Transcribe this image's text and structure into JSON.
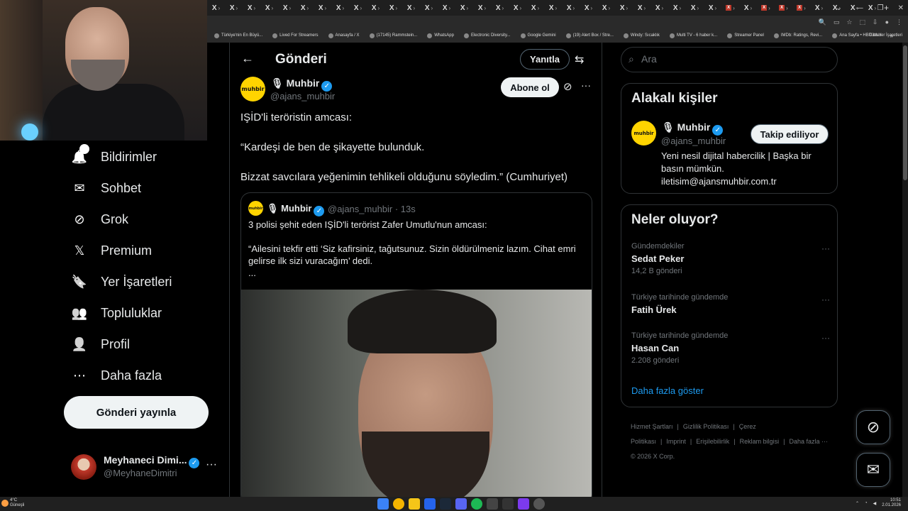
{
  "browser": {
    "tab_labels": [
      "X",
      "X",
      "X",
      "X",
      "X",
      "X",
      "X",
      "X",
      "X",
      "X",
      "X",
      "X",
      "X",
      "X",
      "X",
      "X",
      "X",
      "X",
      "X",
      "X",
      "X",
      "X",
      "X",
      "X",
      "X",
      "X",
      "X",
      "X",
      "X",
      "X",
      "X",
      "X",
      "X",
      "X",
      "X",
      "X",
      "X",
      "X"
    ],
    "new_tab": "+",
    "bookmarks": [
      "Türkiye'nin En Büyü...",
      "Lived For Streamers",
      "Anasayfa / X",
      "(17145) Rammstein...",
      "WhatsApp",
      "Electronic Diversity...",
      "Google Gemini",
      "(19) Alert Box / Stre...",
      "Windy: Sıcaklık",
      "Multi TV - 6 haber k...",
      "Streamer Panel",
      "IMDb: Ratings, Revi...",
      "Ana Sayfa • HBO Max"
    ],
    "bookmarks_overflow": "»",
    "all_bookmarks": "Tüm Yer İşaretleri"
  },
  "nav": {
    "items": [
      {
        "label": "Bildirimler",
        "icon": "bell-icon",
        "badge": "2"
      },
      {
        "label": "Sohbet",
        "icon": "envelope-icon"
      },
      {
        "label": "Grok",
        "icon": "grok-icon"
      },
      {
        "label": "Premium",
        "icon": "x-logo-icon"
      },
      {
        "label": "Yer İşaretleri",
        "icon": "bookmark-icon"
      },
      {
        "label": "Topluluklar",
        "icon": "people-icon"
      },
      {
        "label": "Profil",
        "icon": "person-icon"
      },
      {
        "label": "Daha fazla",
        "icon": "more-circle-icon"
      }
    ],
    "post_button": "Gönderi yayınla",
    "account": {
      "name": "Meyhaneci Dimi...",
      "handle": "@MeyhaneDimitri"
    }
  },
  "main": {
    "title": "Gönderi",
    "reply_button": "Yanıtla",
    "author": {
      "name": "Muhbir",
      "handle": "@ajans_muhbir",
      "logo": "muhbir"
    },
    "subscribe_button": "Abone ol",
    "text": [
      "IŞİD'li teröristin amcası:",
      "“Kardeşi de ben de şikayette bulunduk.",
      "Bizzat savcılara yeğenimin tehlikeli olduğunu söyledim.” (Cumhuriyet)"
    ],
    "quote": {
      "name": "Muhbir",
      "handle": "@ajans_muhbir · 13s",
      "logo": "muhbir",
      "lines": [
        "3 polisi şehit eden IŞİD'li terörist Zafer Umutlu'nun amcası:",
        "“Ailesini tekfir etti ‘Siz kafirsiniz, tağutsunuz. Sizin öldürülmeniz lazım. Cihat emri gelirse ilk sizi vuracağım’ dedi.",
        "..."
      ]
    }
  },
  "right": {
    "search_placeholder": "Ara",
    "related": {
      "title": "Alakalı kişiler",
      "name": "Muhbir",
      "handle": "@ajans_muhbir",
      "logo": "muhbir",
      "follow_button": "Takip ediliyor",
      "bio": "Yeni nesil dijital habercilik | Başka bir basın mümkün. iletisim@ajansmuhbir.com.tr"
    },
    "trends": {
      "title": "Neler oluyor?",
      "items": [
        {
          "context": "Gündemdekiler",
          "title": "Sedat Peker",
          "count": "14,2 B gönderi"
        },
        {
          "context": "Türkiye tarihinde gündemde",
          "title": "Fatih Ürek",
          "count": ""
        },
        {
          "context": "Türkiye tarihinde gündemde",
          "title": "Hasan Can",
          "count": "2.208 gönderi"
        }
      ],
      "show_more": "Daha fazla göster"
    },
    "footer": {
      "links": [
        "Hizmet Şartları",
        "|",
        "Gizlilik Politikası",
        "|",
        "Çerez Politikası",
        "|",
        "Imprint",
        "|",
        "Erişilebilirlik",
        "|",
        "Reklam bilgisi",
        "|",
        "Daha fazla ···"
      ],
      "copyright": "© 2026 X Corp."
    }
  },
  "taskbar": {
    "weather_temp": "4°C",
    "weather_desc": "Güneşli",
    "time": "10:51",
    "date": "2.01.2026"
  }
}
